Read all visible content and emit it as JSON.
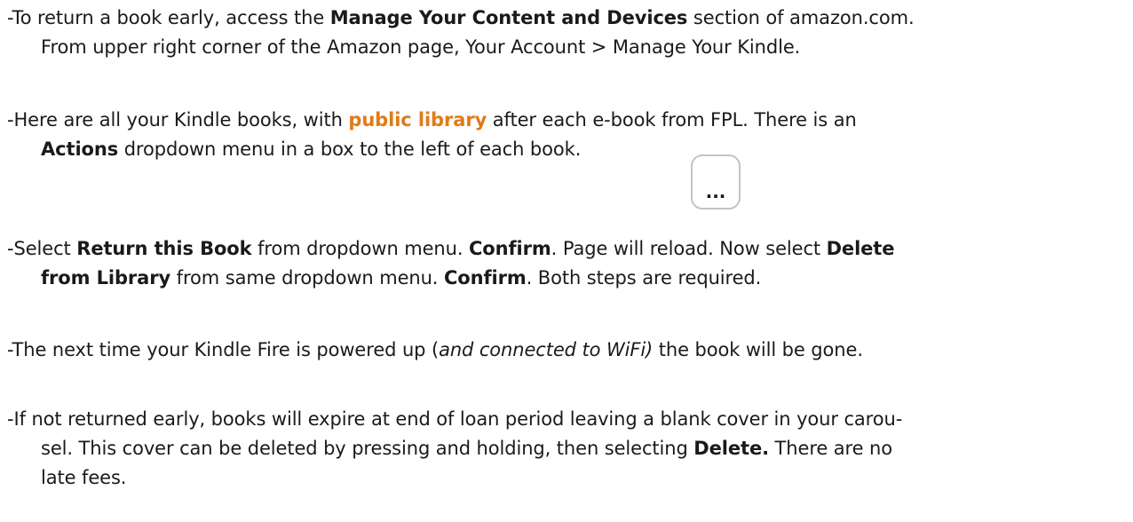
{
  "paragraphs": {
    "p1": {
      "l1a": "-To return a book early, access the ",
      "l1b": "Manage Your Content and Devices",
      "l1c": " section of amazon.com.",
      "l2": "From upper right corner of the Amazon page,  Your Account > Manage Your Kindle."
    },
    "p2": {
      "l1a": "-Here are all your Kindle books, with ",
      "l1b": "public library",
      "l1c": " after each e-book from FPL. There is an",
      "l2a": "Actions",
      "l2b": " dropdown menu in a box to the left of each book."
    },
    "p3": {
      "l1a": "-Select ",
      "l1b": "Return this Book",
      "l1c": " from dropdown menu. ",
      "l1d": "Confirm",
      "l1e": ". Page will reload. Now select ",
      "l1f": "Delete",
      "l2a": "from Library",
      "l2b": " from same dropdown menu. ",
      "l2c": "Confirm",
      "l2d": ". Both steps are required."
    },
    "p4": {
      "a": "-The next time your Kindle Fire is powered up (",
      "b": "and connected to WiFi)",
      "c": " the book will be gone."
    },
    "p5": {
      "l1": "-If not returned early, books will expire at end of loan period leaving a blank cover in your carou-",
      "l2a": "sel. This cover can be deleted by pressing and holding, then selecting ",
      "l2b": "Delete.",
      "l2c": " There are no",
      "l3": "late fees."
    }
  },
  "actions_button": {
    "label": "..."
  },
  "colors": {
    "accent": "#e07b17",
    "text": "#1a1a1a",
    "button_border": "#c4c4c4"
  }
}
